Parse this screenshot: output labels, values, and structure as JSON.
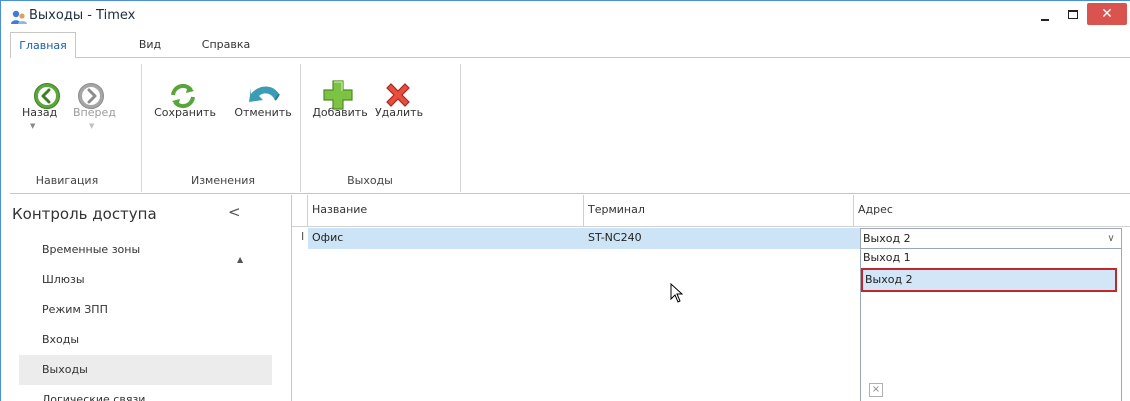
{
  "window": {
    "title": "Выходы - Timex",
    "buttons": {
      "minimize": "_",
      "maximize": "□",
      "close": "✕"
    }
  },
  "tabs": [
    {
      "label": "Главная",
      "active": true
    },
    {
      "label": "Вид",
      "active": false
    },
    {
      "label": "Справка",
      "active": false
    }
  ],
  "ribbon": {
    "groups": [
      {
        "label": "Навигация",
        "buttons": [
          {
            "label": "Назад",
            "icon": "arrow-left-icon",
            "enabled": true
          },
          {
            "label": "Вперед",
            "icon": "arrow-right-icon",
            "enabled": false
          }
        ]
      },
      {
        "label": "Изменения",
        "buttons": [
          {
            "label": "Сохранить",
            "icon": "refresh-icon"
          },
          {
            "label": "Отменить",
            "icon": "undo-icon"
          }
        ]
      },
      {
        "label": "Выходы",
        "buttons": [
          {
            "label": "Добавить",
            "icon": "plus-icon"
          },
          {
            "label": "Удалить",
            "icon": "delete-x-icon"
          }
        ]
      }
    ]
  },
  "sidebar": {
    "title": "Контроль доступа",
    "collapse_glyph": "<",
    "items": [
      {
        "label": "Временные зоны",
        "selected": false,
        "expander": "▲"
      },
      {
        "label": "Шлюзы",
        "selected": false
      },
      {
        "label": "Режим ЗПП",
        "selected": false
      },
      {
        "label": "Входы",
        "selected": false
      },
      {
        "label": "Выходы",
        "selected": true
      },
      {
        "label": "Логические связи",
        "selected": false
      }
    ]
  },
  "grid": {
    "columns": [
      "Название",
      "Терминал",
      "Адрес"
    ],
    "rows": [
      {
        "name": "Офис",
        "terminal": "ST-NC240",
        "address": "Выход 2"
      }
    ],
    "row_indicator": "I"
  },
  "address_dropdown": {
    "selected": "Выход 2",
    "options": [
      "Выход 1",
      "Выход 2"
    ],
    "highlighted": "Выход 2",
    "clear_glyph": "×",
    "arrow_glyph": "∨"
  },
  "colors": {
    "accent_blue": "#1c5ea8",
    "row_highlight": "#cce4f5",
    "highlight_border": "#c0272d",
    "close_red": "#d9534f"
  }
}
